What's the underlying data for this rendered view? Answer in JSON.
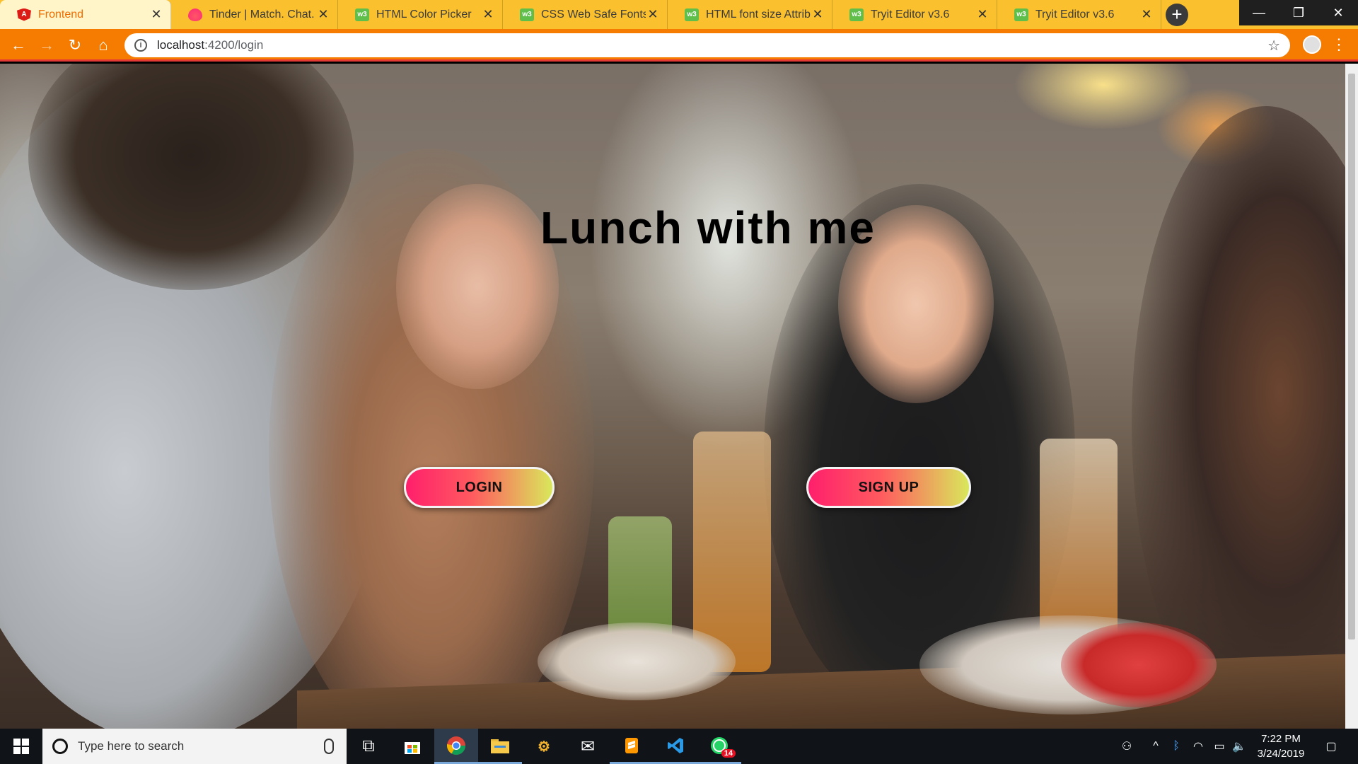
{
  "browser": {
    "tabs": [
      {
        "title": "Frontend",
        "favicon": "angular-icon",
        "active": true
      },
      {
        "title": "Tinder | Match. Chat. Date.",
        "favicon": "tinder-icon",
        "active": false
      },
      {
        "title": "HTML Color Picker",
        "favicon": "w3schools-icon",
        "active": false
      },
      {
        "title": "CSS Web Safe Fonts",
        "favicon": "w3schools-icon",
        "active": false
      },
      {
        "title": "HTML font size Attribute",
        "favicon": "w3schools-icon",
        "active": false
      },
      {
        "title": "Tryit Editor v3.6",
        "favicon": "w3schools-icon",
        "active": false
      },
      {
        "title": "Tryit Editor v3.6",
        "favicon": "w3schools-icon",
        "active": false
      }
    ],
    "new_tab_label": "+",
    "url_host": "localhost",
    "url_path": ":4200/login",
    "theme": {
      "tabstrip": "#fbc02d",
      "toolbar": "#f57c00",
      "accent_line": "#e53935"
    }
  },
  "page": {
    "headline": "Lunch with me",
    "login_label": "LOGIN",
    "signup_label": "SIGN UP",
    "button_gradient": [
      "#ff1f6c",
      "#ff5a5f",
      "#d9e85b"
    ]
  },
  "taskbar": {
    "search_placeholder": "Type here to search",
    "apps": [
      "task-view-icon",
      "store-icon",
      "chrome-icon",
      "file-explorer-icon",
      "app-icon",
      "mail-icon",
      "sublime-text-icon",
      "vscode-icon",
      "whatsapp-icon"
    ],
    "whatsapp_badge": "14",
    "time": "7:22 PM",
    "date": "3/24/2019"
  }
}
